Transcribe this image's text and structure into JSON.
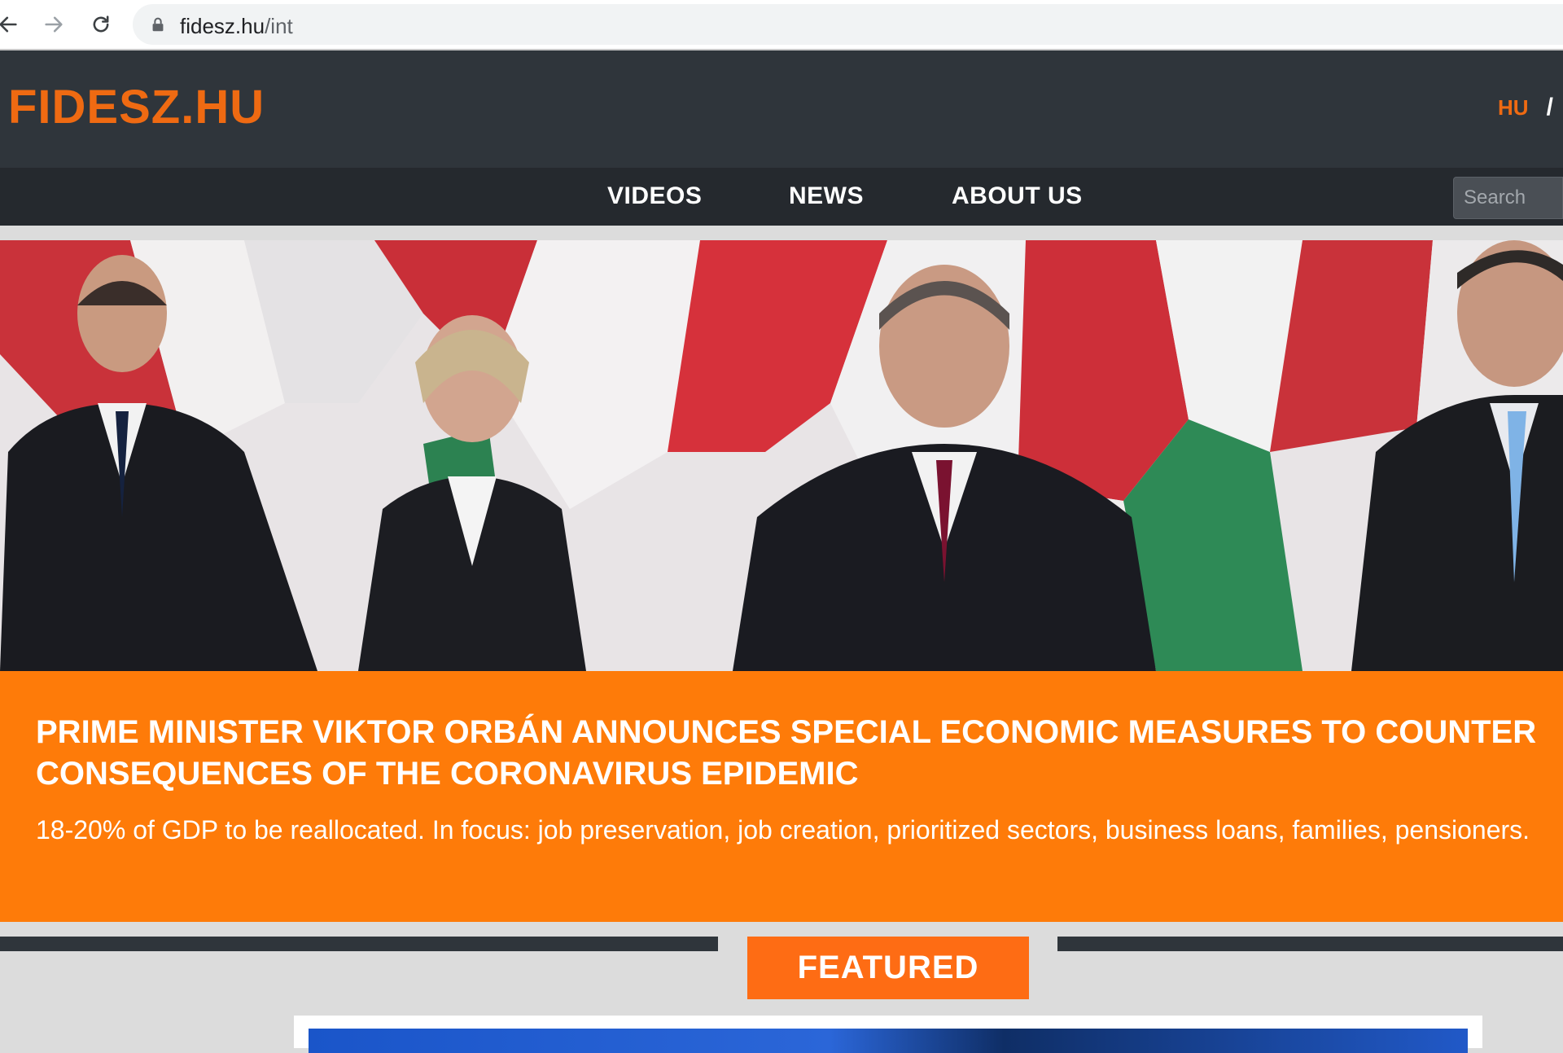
{
  "browser": {
    "back_icon": "arrow-left-icon",
    "forward_icon": "arrow-right-icon",
    "reload_icon": "reload-icon",
    "lock_icon": "lock-icon",
    "url_domain": "fidesz.hu",
    "url_path": "/int"
  },
  "header": {
    "logo": "FIDESZ.HU",
    "lang_active": "HU",
    "lang_separator": "/"
  },
  "nav": {
    "items": [
      {
        "label": "VIDEOS"
      },
      {
        "label": "NEWS"
      },
      {
        "label": "ABOUT US"
      }
    ],
    "search_placeholder": "Search"
  },
  "hero": {
    "image_icon": "hero-photo"
  },
  "headline": {
    "title": "PRIME MINISTER VIKTOR ORBÁN ANNOUNCES SPECIAL ECONOMIC MEASURES TO COUNTER CONSEQUENCES OF THE CORONAVIRUS EPIDEMIC",
    "subtitle": "18-20% of GDP to be reallocated. In focus: job preservation, job creation, prioritized sectors, business loans, families, pensioners."
  },
  "featured": {
    "label": "FEATURED"
  },
  "colors": {
    "accent_orange": "#fe7b09",
    "logo_orange": "#ef6a12",
    "header_dark": "#2f353b",
    "nav_dark": "#25292e"
  }
}
